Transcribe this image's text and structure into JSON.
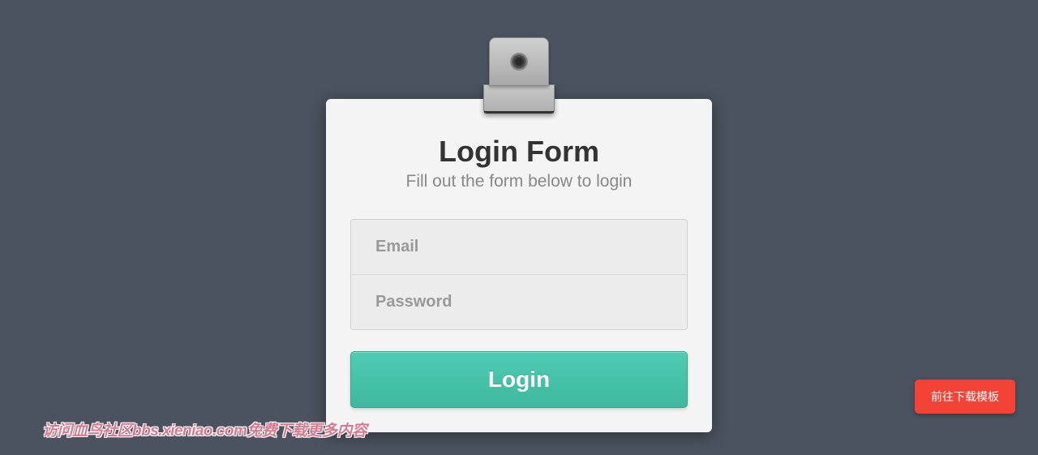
{
  "form": {
    "title": "Login Form",
    "subtitle": "Fill out the form below to login",
    "email": {
      "placeholder": "Email",
      "value": ""
    },
    "password": {
      "placeholder": "Password",
      "value": ""
    },
    "submit_label": "Login"
  },
  "watermark": {
    "text": "访问血鸟社区bbs.xieniao.com免费下载更多内容"
  },
  "cta": {
    "download_label": "前往下载模板"
  }
}
